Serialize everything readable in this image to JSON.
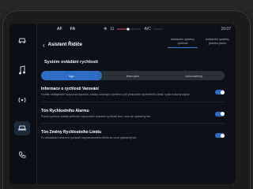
{
  "status_bar": {
    "label_1": "AF",
    "label_2": "FA",
    "temp_left": "11",
    "ac_label": "A/C",
    "temp_right": "",
    "time": "15:07"
  },
  "header": {
    "back_icon": "chevron-left",
    "title": "Asistent Řidiče"
  },
  "mode_tabs": [
    {
      "label": "Asistenční systémy rychlosti"
    },
    {
      "label": "Asistenční systémy jízdního pruhu"
    }
  ],
  "sidebar": {
    "items": [
      {
        "icon": "car-icon",
        "active": false
      },
      {
        "icon": "music-icon",
        "active": false
      },
      {
        "icon": "signal-icon",
        "active": false
      },
      {
        "icon": "car-front-icon",
        "active": true
      },
      {
        "icon": "phone-icon",
        "active": false
      }
    ]
  },
  "main": {
    "section_title": "Systém ovládání rychlosti",
    "segments": [
      {
        "label": "Vyp.",
        "selected": true
      },
      {
        "label": "Manuální",
        "selected": false
      },
      {
        "label": "Automatický",
        "selected": false
      }
    ],
    "rows": [
      {
        "title": "Informace o rychlosti Varování",
        "desc": "Vozidlo inteligentně rozpozná dopravní značky omezující rychlost a při překročení rychlostního limitu vydá zvukový signál",
        "toggle_on": true
      },
      {
        "title": "Tón Rychlostního Alarmu",
        "desc": "Pokud rychlost vozidla překročí rozpoznané omezení rychlosti tent, ozve se výstražný tón",
        "toggle_on": true
      },
      {
        "title": "Tón Změny Rychlostního Limitu",
        "desc": "Po aktualizaci omezení rychlosti rozpoznávaného limitu se ozve výstražný tón",
        "toggle_on": true
      }
    ]
  },
  "colors": {
    "accent": "#2f6dc4",
    "background": "#0d1117"
  }
}
